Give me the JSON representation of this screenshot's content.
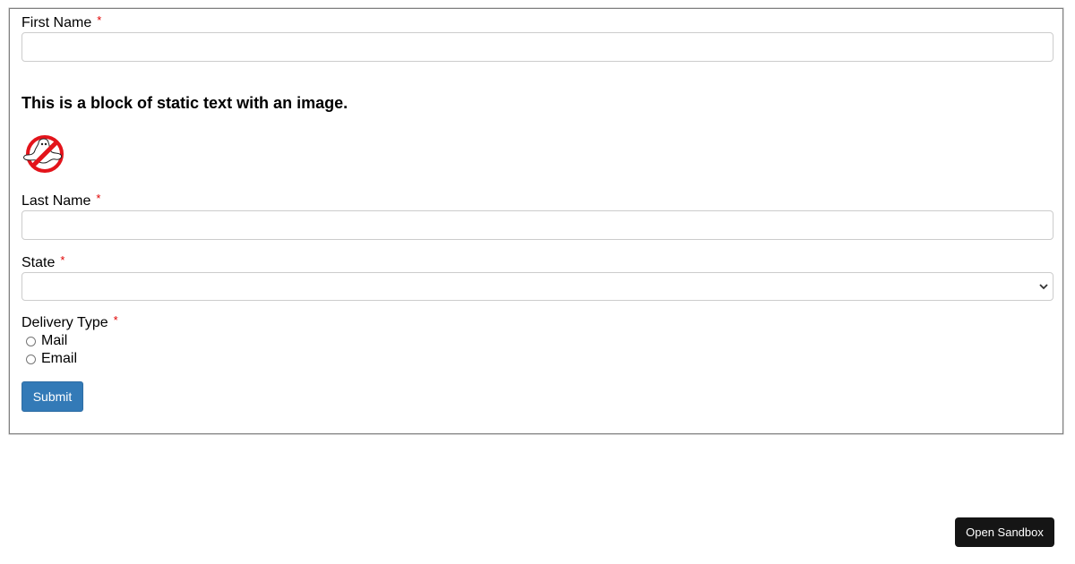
{
  "form": {
    "first_name": {
      "label": "First Name",
      "required_mark": "*",
      "value": ""
    },
    "static_text": "This is a block of static text with an image.",
    "logo_icon": "ghostbusters-logo-icon",
    "last_name": {
      "label": "Last Name",
      "required_mark": "*",
      "value": ""
    },
    "state": {
      "label": "State",
      "required_mark": "*",
      "selected": ""
    },
    "delivery_type": {
      "label": "Delivery Type",
      "required_mark": "*",
      "options": [
        "Mail",
        "Email"
      ]
    },
    "submit_label": "Submit"
  },
  "open_sandbox_label": "Open Sandbox",
  "colors": {
    "primary_button": "#337ab7",
    "required_star": "#e00000",
    "sandbox_button": "#151515"
  }
}
